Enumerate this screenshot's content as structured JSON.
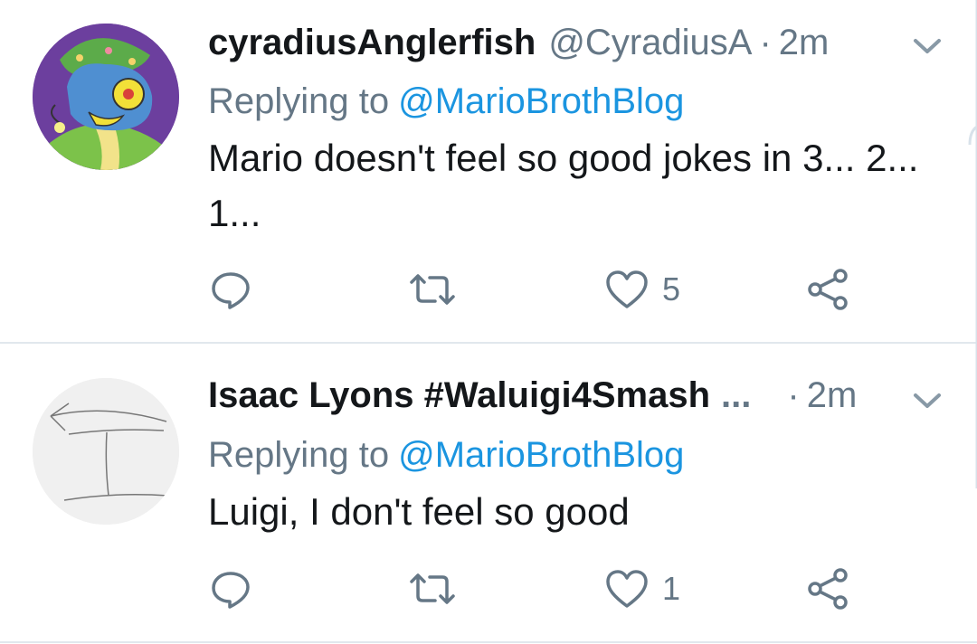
{
  "tweets": [
    {
      "display_name": "cyradiusAnglerfish",
      "handle": "@CyradiusA",
      "separator": "·",
      "time": "2m",
      "replying_prefix": "Replying to",
      "replying_to": "@MarioBrothBlog",
      "text": "Mario doesn't feel so good jokes in 3... 2... 1...",
      "reply_count": "",
      "retweet_count": "",
      "like_count": "5"
    },
    {
      "display_name": "Isaac Lyons #Waluigi4Smash",
      "name_truncation": "...",
      "handle": "",
      "separator": "·",
      "time": "2m",
      "replying_prefix": "Replying to",
      "replying_to": "@MarioBrothBlog",
      "text": "Luigi, I don't feel so good",
      "reply_count": "",
      "retweet_count": "",
      "like_count": "1"
    }
  ],
  "icons": {
    "reply": "reply-icon",
    "retweet": "retweet-icon",
    "like": "heart-icon",
    "share": "share-icon",
    "menu": "chevron-down-icon"
  },
  "colors": {
    "text": "#14171a",
    "secondary": "#657786",
    "link": "#1b95e0",
    "divider": "#e1e8ed"
  }
}
